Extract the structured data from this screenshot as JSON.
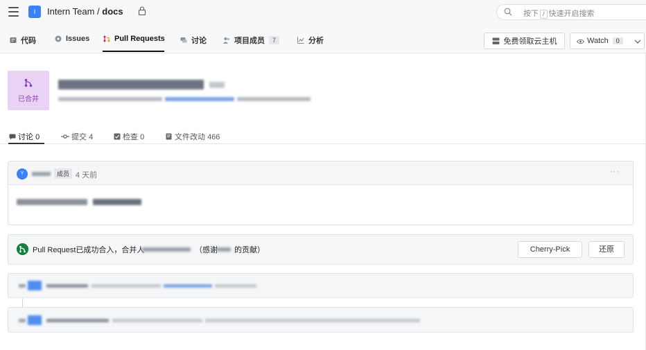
{
  "header": {
    "team": "Intern Team",
    "separator": "/",
    "repo": "docs",
    "search": {
      "prefix": "按下",
      "key": "/",
      "suffix": "快速开启搜索"
    }
  },
  "nav": {
    "tabs": [
      {
        "label": "代码"
      },
      {
        "label": "Issues"
      },
      {
        "label": "Pull Requests"
      },
      {
        "label": "讨论"
      },
      {
        "label": "项目成员",
        "count": "7"
      },
      {
        "label": "分析"
      }
    ],
    "host_button": "免费领取云主机",
    "watch_label": "Watch",
    "watch_count": "0"
  },
  "pr": {
    "status": "已合并"
  },
  "subtabs": [
    {
      "label": "讨论",
      "count": "0"
    },
    {
      "label": "提交",
      "count": "4"
    },
    {
      "label": "检查",
      "count": "0"
    },
    {
      "label": "文件改动",
      "count": "466"
    }
  ],
  "comment": {
    "avatar_letter": "Y",
    "role": "成员",
    "time": "4 天前",
    "more": "···"
  },
  "merge": {
    "text_prefix": "Pull Request已成功合入，合并人",
    "thanks_prefix": "（感谢",
    "thanks_suffix": "的贡献）",
    "cherry_pick": "Cherry-Pick",
    "revert": "还原"
  },
  "colors": {
    "merged_bg": "#e8d3f5",
    "merged_fg": "#8a3fbf",
    "merge_icon": "#15803d",
    "accent": "#3b82f6",
    "pr_tab_icon": "#e11d48"
  },
  "icons": [
    "menu-icon",
    "lock-icon",
    "search-icon",
    "code-icon",
    "issues-icon",
    "pull-request-icon",
    "discussion-icon",
    "members-icon",
    "analytics-icon",
    "server-icon",
    "eye-icon",
    "chevron-down-icon",
    "merge-icon",
    "commit-icon",
    "check-icon",
    "file-icon"
  ]
}
